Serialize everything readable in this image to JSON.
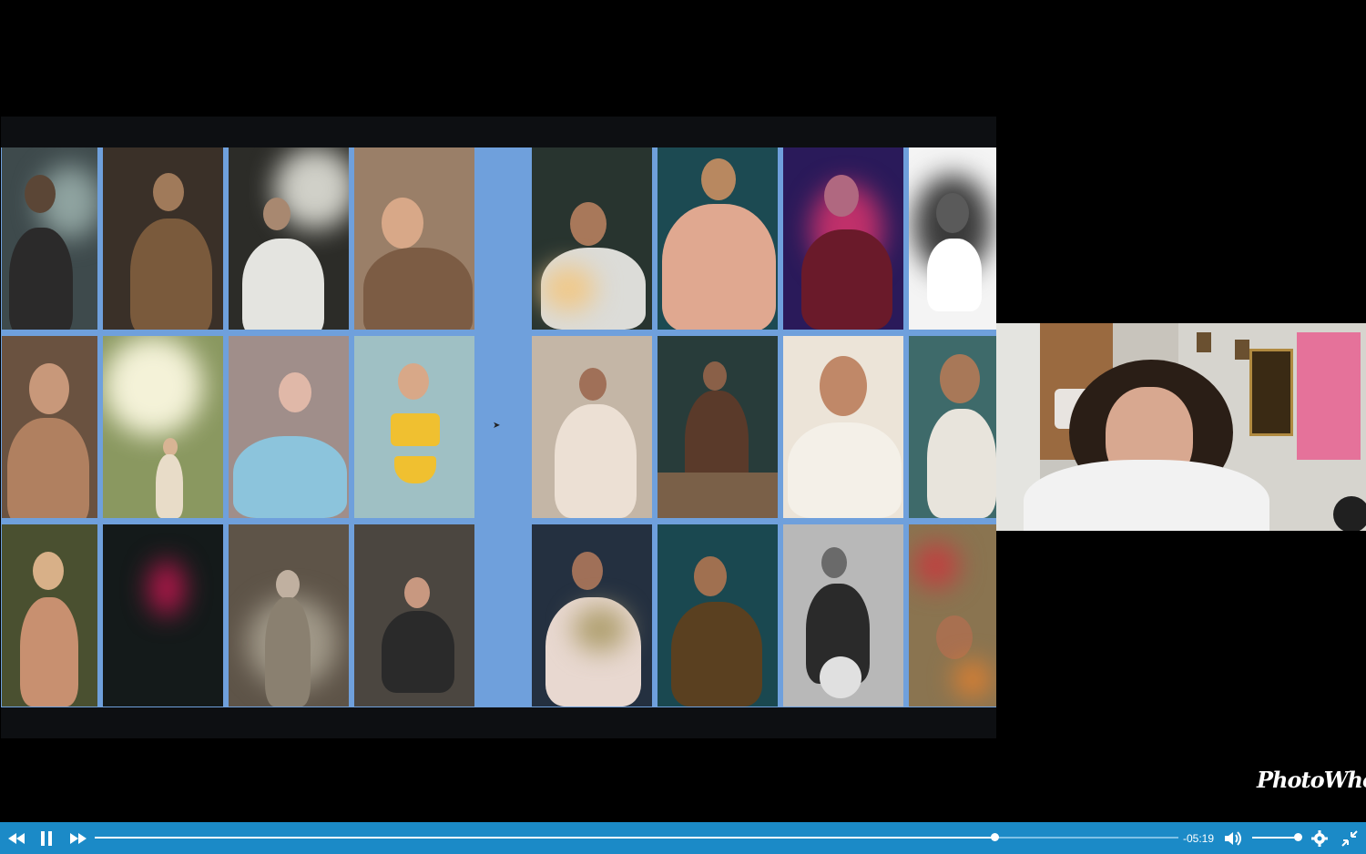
{
  "video": {
    "watermark": "PhotoWhoa",
    "progress_fraction": 0.83,
    "remaining_time": "-05:19",
    "volume_fraction": 1.0,
    "state": "playing"
  },
  "controls": {
    "rewind_icon": "rewind-icon",
    "pause_icon": "pause-icon",
    "forward_icon": "fast-forward-icon",
    "volume_icon": "volume-icon",
    "settings_icon": "gear-icon",
    "exit_fullscreen_icon": "exit-fullscreen-icon"
  },
  "slide": {
    "background_color": "#6fa0dc",
    "left_grid": [
      [
        "#3e4a4c",
        "#5a4838",
        "#2c2c28",
        "#9a7f68"
      ],
      [
        "#6a5240",
        "#9aa070",
        "#a08e8a",
        "#9fc0c4"
      ],
      [
        "#4a5030",
        "#141a1a",
        "#5e5448",
        "#4b4640"
      ]
    ],
    "right_grid": [
      [
        "#28342f",
        "#1c4a52",
        "#2a1a5a",
        "#e8e8e8"
      ],
      [
        "#c4b6a6",
        "#283c3a",
        "#ece4d8",
        "#3e6a6a"
      ],
      [
        "#243040",
        "#1a4850",
        "#b8b8b8",
        "#8a7450"
      ]
    ]
  }
}
